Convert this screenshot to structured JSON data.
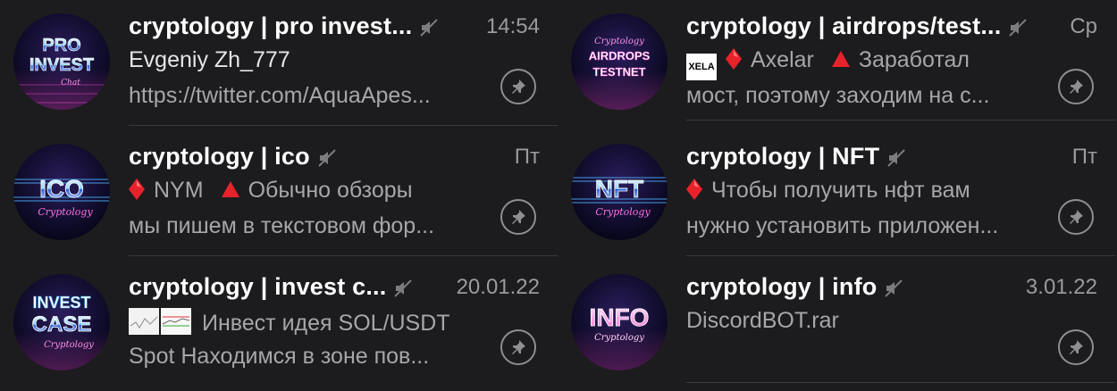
{
  "chats_left": [
    {
      "title": "cryptology | pro invest...",
      "time": "14:54",
      "sender": "Evgeniy Zh_777",
      "preview": "https://twitter.com/AquaApes...",
      "avatar_text": [
        "PRO",
        "INVEST"
      ],
      "avatar_script": "Chat"
    },
    {
      "title": "cryptology | ico",
      "time": "Пт",
      "line1_a": "NYM",
      "line1_b": "Обычно обзоры",
      "preview": "мы пишем в текстовом фор...",
      "avatar_text": [
        "ICO"
      ],
      "avatar_script": "Cryptology"
    },
    {
      "title": "cryptology | invest c...",
      "time": "20.01.22",
      "line1": "Инвест идея SOL/USDT",
      "preview": "Spot  Находимся в зоне пов...",
      "avatar_text": [
        "INVEST",
        "CASE"
      ],
      "avatar_script": "Cryptology"
    }
  ],
  "chats_right": [
    {
      "title": "cryptology | airdrops/test...",
      "time": "Ср",
      "logo_text": "XELA",
      "line1_a": "Axelar",
      "line1_b": "Заработал",
      "preview": "мост, поэтому заходим на с...",
      "avatar_text": [
        "AIRDROPS",
        "TESTNET"
      ],
      "avatar_script": "Cryptology"
    },
    {
      "title": "cryptology | NFT",
      "time": "Пт",
      "line1": "Чтобы получить нфт вам",
      "preview": "нужно установить приложен...",
      "avatar_text": [
        "NFT"
      ],
      "avatar_script": "Cryptology"
    },
    {
      "title": "cryptology | info",
      "time": "3.01.22",
      "line1": "DiscordBOT.rar",
      "avatar_text": [
        "INFO"
      ],
      "avatar_script": "Cryptology"
    }
  ],
  "icons": {
    "mute": "muted-speaker-icon",
    "pin": "pin-icon",
    "red_diamond": "red-diamond-emoji",
    "red_triangle": "red-triangle-emoji"
  },
  "colors": {
    "background": "#1c1c1e",
    "title": "#ffffff",
    "secondary": "#a6a6ab",
    "separator": "#3a3a3c",
    "accent_neon_pink": "#ff4fd8",
    "accent_neon_blue": "#4fb4ff"
  }
}
